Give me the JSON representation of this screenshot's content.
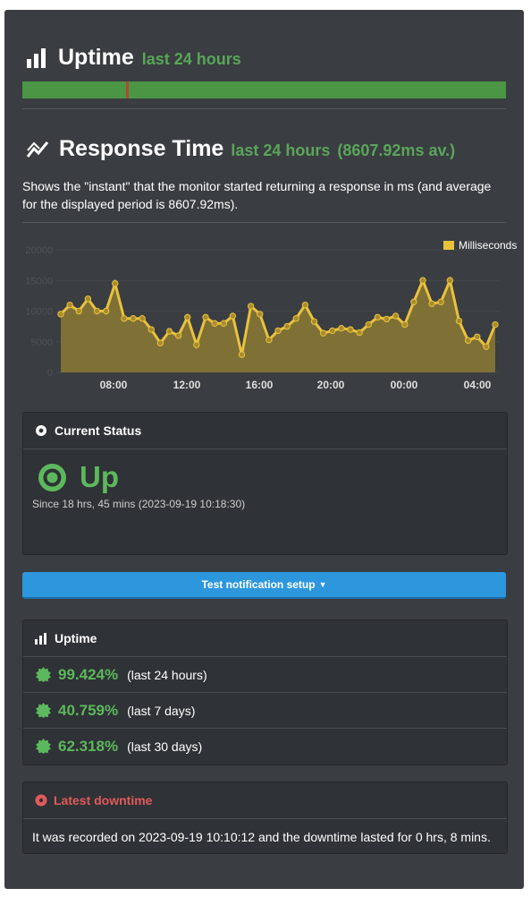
{
  "uptime_header": {
    "title": "Uptime",
    "subtitle": "last 24 hours",
    "bar_up_color": "#4a9645",
    "bar_down_color": "#b04a2e",
    "downtime_fraction": 0.005
  },
  "response_header": {
    "title": "Response Time",
    "subtitle": "last 24 hours",
    "average": "(8607.92ms av.)"
  },
  "response_desc": "Shows the \"instant\" that the monitor started returning a response in ms (and average for the displayed period is 8607.92ms).",
  "chart_data": {
    "type": "area",
    "legend": [
      "Milliseconds"
    ],
    "legend_position": "top-right",
    "ylim": [
      0,
      20000
    ],
    "yticks": [
      "20000",
      "15000",
      "10000",
      "5000",
      "0"
    ],
    "xticks": [
      "08:00",
      "12:00",
      "16:00",
      "20:00",
      "00:00",
      "04:00"
    ],
    "series": [
      {
        "name": "Milliseconds",
        "values": [
          9500,
          11000,
          10000,
          12000,
          10000,
          10000,
          14500,
          8800,
          8800,
          8800,
          7000,
          4800,
          6700,
          6000,
          9000,
          4500,
          9000,
          8000,
          8000,
          9200,
          2900,
          10800,
          9500,
          5300,
          6800,
          7500,
          8800,
          11000,
          8300,
          6400,
          6800,
          7200,
          7000,
          6500,
          7800,
          9000,
          8700,
          9200,
          7800,
          11500,
          15000,
          11200,
          11500,
          15000,
          8400,
          5200,
          5800,
          4200,
          7800
        ]
      }
    ],
    "color": "#e9c23d"
  },
  "current_status": {
    "heading": "Current Status",
    "status": "Up",
    "since": "Since 18 hrs, 45 mins (2023-09-19 10:18:30)"
  },
  "notify_button": "Test notification setup",
  "uptime_card": {
    "heading": "Uptime",
    "rows": [
      {
        "percent": "99.424%",
        "period": "(last 24 hours)"
      },
      {
        "percent": "40.759%",
        "period": "(last 7 days)"
      },
      {
        "percent": "62.318%",
        "period": "(last 30 days)"
      }
    ]
  },
  "latest_downtime": {
    "heading": "Latest downtime",
    "text": "It was recorded on 2023-09-19 10:10:12 and the downtime lasted for 0 hrs, 8 mins."
  }
}
